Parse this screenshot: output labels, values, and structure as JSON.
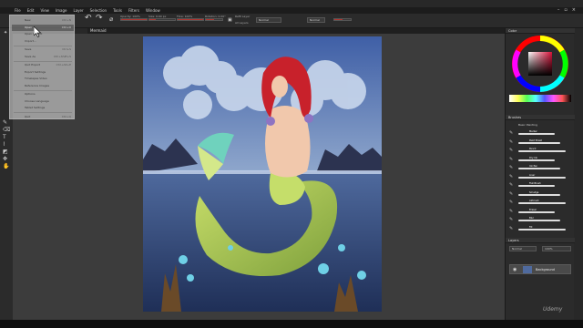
{
  "menubar": {
    "items": [
      "File",
      "Edit",
      "View",
      "Image",
      "Layer",
      "Selection",
      "Tools",
      "Filters",
      "Window"
    ],
    "window_buttons": [
      "–",
      "▫",
      "×"
    ]
  },
  "toolbar": {
    "opacity_label": "Opacity: 100%",
    "opacity_value": 1.0,
    "size_label": "Size: 6.60 px",
    "size_value": 0.25,
    "flow_label": "Flow: 100%",
    "flow_value": 1.0,
    "rotation_label": "Rotation: 0.00°",
    "rotation_value": 0.5,
    "blend_mode": "Normal",
    "brush_preset": "Normal",
    "refit_label": "Refit",
    "refit_layer_label": "Refit Layer",
    "all_layers_label": "All Layers"
  },
  "document": {
    "tab_label": "Mermaid"
  },
  "file_menu": {
    "items": [
      {
        "label": "New",
        "shortcut": "Ctrl+N",
        "highlight": false
      },
      {
        "label": "Open",
        "shortcut": "Ctrl+O",
        "highlight": true
      },
      {
        "label": "Open Recent",
        "shortcut": "",
        "highlight": false
      },
      {
        "label": "Import...",
        "shortcut": "",
        "highlight": false
      },
      {
        "label": "Save",
        "shortcut": "Ctrl+S",
        "highlight": false
      },
      {
        "label": "Save As",
        "shortcut": "Ctrl+Shift+S",
        "highlight": false
      },
      {
        "label": "Quit Export",
        "shortcut": "Ctrl+Alt+E",
        "highlight": false
      },
      {
        "label": "Export Settings",
        "shortcut": "",
        "highlight": false
      },
      {
        "label": "Timelapse Video",
        "shortcut": "",
        "highlight": false
      },
      {
        "label": "Reference Images",
        "shortcut": "",
        "highlight": false
      },
      {
        "label": "Options",
        "shortcut": "",
        "highlight": false
      },
      {
        "label": "Choose Language",
        "shortcut": "",
        "highlight": false
      },
      {
        "label": "Tablet Settings",
        "shortcut": "",
        "highlight": false
      },
      {
        "label": "Quit",
        "shortcut": "Ctrl+Q",
        "highlight": false
      }
    ]
  },
  "right_dock": {
    "color_title": "Color",
    "brushes_title": "Brushes",
    "brush_category": "Basic Painting",
    "brushes": [
      "Marker",
      "Paint Brush",
      "Pencil",
      "Dry Ink",
      "Ink Pen",
      "Liner",
      "Flat Brush",
      "Smudge",
      "Airbrush",
      "Eraser",
      "Blur",
      "Fill"
    ],
    "layers_title": "Layers",
    "layer_blend": "Normal",
    "layer_opacity": "100%",
    "layer_name": "Background"
  },
  "watermark": "Udemy",
  "colors": {
    "accent": "#b0352f",
    "panel": "#2b2b2b",
    "canvas_bg": "#3c3c3c"
  }
}
